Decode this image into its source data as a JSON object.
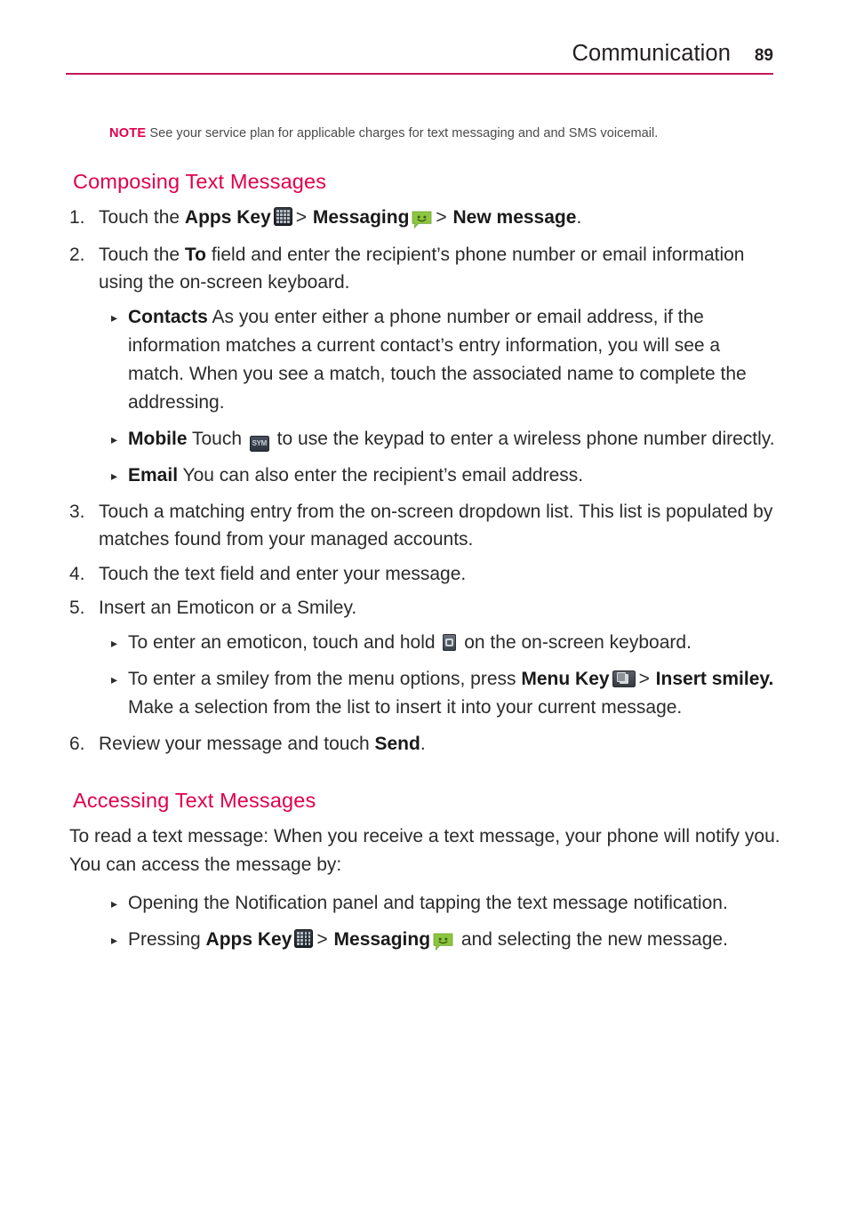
{
  "header": {
    "title": "Communication",
    "page_number": "89",
    "rule_color": "#c2185b"
  },
  "note": {
    "label": "NOTE",
    "text": "See your service plan for applicable charges for text messaging and and SMS voicemail."
  },
  "sections": {
    "composing": {
      "heading": "Composing Text Messages",
      "heading_color": "#e0004d",
      "steps": {
        "s1": {
          "marker": "1.",
          "p1": "Touch the ",
          "b1": "Apps Key",
          "icon1": "apps-key-icon",
          "gt1": ">",
          "b2": "Messaging",
          "icon2": "messaging-icon",
          "gt2": ">",
          "b3": "New message",
          "p2": "."
        },
        "s2": {
          "marker": "2.",
          "p1": "Touch the ",
          "b1": "To",
          "p2": " field and enter the recipient’s phone number or email information using the on-screen keyboard."
        },
        "s3": {
          "marker": "3.",
          "text": "Touch a matching entry from the on-screen dropdown list. This list is populated by matches found from your managed accounts."
        },
        "s4": {
          "marker": "4.",
          "text": "Touch the text field and enter your message."
        },
        "s5": {
          "marker": "5.",
          "text": "Insert an Emoticon or a Smiley."
        },
        "s6": {
          "marker": "6.",
          "p1": "Review your message and touch ",
          "b1": "Send",
          "p2": "."
        }
      },
      "bullets": {
        "contacts": {
          "marker": "▸",
          "b1": "Contacts",
          "text": " As you enter either a phone number or email address, if the information matches a current contact’s entry information, you will see a match. When you see a match, touch the associated name to complete the addressing."
        },
        "mobile": {
          "marker": "▸",
          "b1": "Mobile",
          "p1": " Touch ",
          "icon1": "sym-key-icon",
          "p2": " to use the keypad to enter a wireless phone number directly."
        },
        "email": {
          "marker": "▸",
          "b1": "Email",
          "text": " You can also enter the recipient’s email address."
        },
        "emoticon": {
          "marker": "▸",
          "p1": "To enter an emoticon, touch and hold ",
          "icon1": "emoticon-key-icon",
          "p2": " on the on-screen keyboard."
        },
        "smiley": {
          "marker": "▸",
          "p1": "To enter a smiley from the menu options, press ",
          "b1": "Menu Key",
          "icon1": "menu-key-icon",
          "gt1": ">",
          "b2": "Insert smiley.",
          "p2": " Make a selection from the list to insert it into your current message."
        }
      }
    },
    "accessing": {
      "heading": "Accessing Text Messages",
      "heading_color": "#e0004d",
      "intro": "To read a text message: When you receive a text message, your phone will notify you. You can access the message by:",
      "bullets": {
        "notification": {
          "marker": "▸",
          "text": "Opening the Notification panel and tapping the text message notification."
        },
        "appskey": {
          "marker": "▸",
          "p1": "Pressing ",
          "b1": "Apps Key",
          "icon1": "apps-key-icon",
          "gt1": ">",
          "b2": "Messaging",
          "icon2": "messaging-icon",
          "p2": " and selecting the new message."
        }
      }
    }
  }
}
